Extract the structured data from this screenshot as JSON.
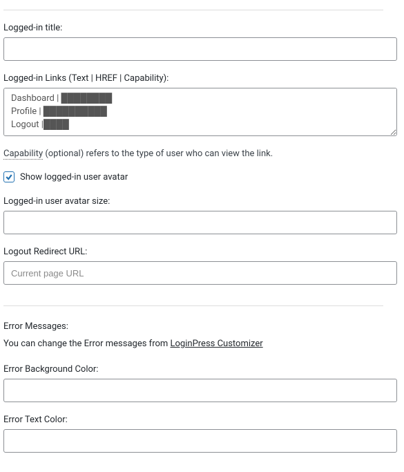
{
  "logged_in_title": {
    "label": "Logged-in title:",
    "value": ""
  },
  "logged_in_links": {
    "label": "Logged-in Links (Text | HREF | Capability):",
    "value": "Dashboard | ████████\nProfile | ██████████\nLogout |████"
  },
  "capability_note": {
    "link_text": "Capability",
    "rest": " (optional) refers to the type of user who can view the link."
  },
  "show_avatar": {
    "label": "Show logged-in user avatar",
    "checked": true
  },
  "avatar_size": {
    "label": "Logged-in user avatar size:",
    "value": ""
  },
  "logout_redirect": {
    "label": "Logout Redirect URL:",
    "value": "",
    "placeholder": "Current page URL"
  },
  "error_section": {
    "heading": "Error Messages:",
    "desc_prefix": "You can change the Error messages from ",
    "desc_link": "LoginPress Customizer"
  },
  "error_bg": {
    "label": "Error Background Color:",
    "value": ""
  },
  "error_text": {
    "label": "Error Text Color:",
    "value": ""
  }
}
